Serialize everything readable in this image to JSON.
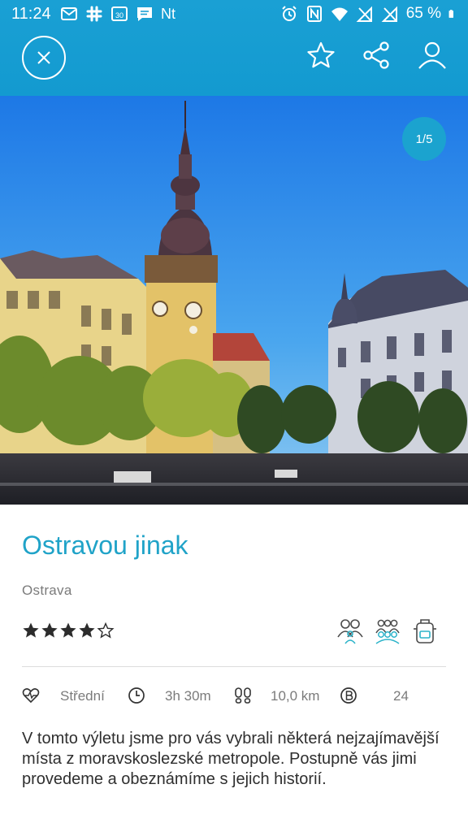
{
  "status_bar": {
    "time": "11:24",
    "notification_icons": [
      "gmail-icon",
      "slack-icon",
      "calendar-icon",
      "message-icon"
    ],
    "nt_label": "Nt",
    "calendar_day": "30",
    "system_icons": [
      "alarm-icon",
      "nfc-icon",
      "wifi-icon",
      "signal-icon",
      "signal-icon"
    ],
    "battery": "65 %"
  },
  "header": {
    "close_icon": "close-icon",
    "actions": [
      "star-icon",
      "share-icon",
      "user-icon"
    ]
  },
  "hero": {
    "counter": "1/5",
    "image_subject": "Ostrava town hall square"
  },
  "detail": {
    "title": "Ostravou jinak",
    "location": "Ostrava",
    "rating": 4,
    "rating_max": 5,
    "tags": [
      "couple-icon",
      "group-icon",
      "backpack-icon"
    ],
    "stats": {
      "difficulty": "Střední",
      "duration": "3h 30m",
      "distance": "10,0 km",
      "points": "24"
    },
    "description": "V tomto výletu jsme pro vás vybrali některá nejzajímavější místa z moravskoslezské metropole. Postupně vás jimi provedeme a obeznámíme s jejich historií."
  },
  "colors": {
    "header": "#1aa0d4",
    "accent": "#20a3c8",
    "text_muted": "#7b7b7b",
    "text": "#2f2f2f"
  }
}
